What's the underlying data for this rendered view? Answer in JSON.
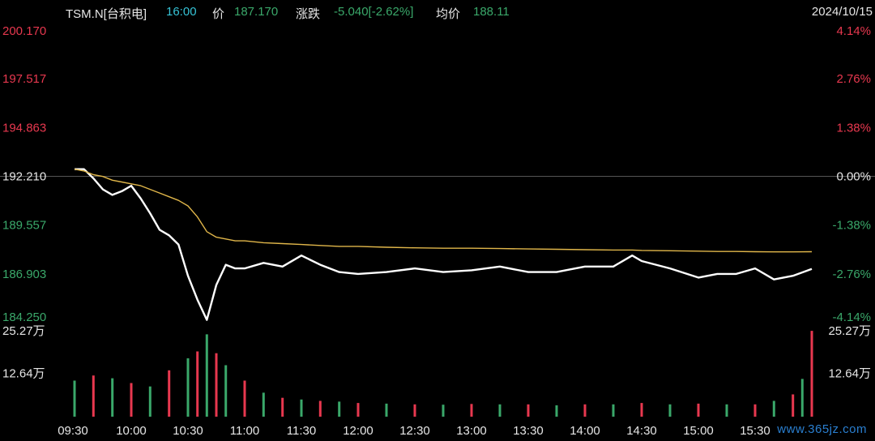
{
  "header": {
    "symbol": "TSM.N[台积电]",
    "time": "16:00",
    "price_label": "价",
    "price": "187.170",
    "change_label": "涨跌",
    "change": "-5.040[-2.62%]",
    "avg_label": "均价",
    "avg": "188.11",
    "date": "2024/10/15"
  },
  "colors": {
    "up": "#e8384f",
    "down": "#3aa86a",
    "price_line": "#ffffff",
    "avg_line": "#e0b64a",
    "base_line": "#555555"
  },
  "watermark": "www.365jz.com",
  "chart_data": [
    {
      "type": "line",
      "title": "",
      "xlabel": "",
      "ylabel": "",
      "x_ticks": [
        "09:30",
        "10:00",
        "10:30",
        "11:00",
        "11:30",
        "12:00",
        "12:30",
        "13:00",
        "13:30",
        "14:00",
        "14:30",
        "15:00",
        "15:30"
      ],
      "y_ticks_left": [
        "200.170",
        "197.517",
        "194.863",
        "192.210",
        "189.557",
        "186.903",
        "184.250"
      ],
      "y_ticks_right": [
        "4.14%",
        "2.76%",
        "1.38%",
        "0.00%",
        "-1.38%",
        "-2.76%",
        "-4.14%"
      ],
      "ylim": [
        184.25,
        200.17
      ],
      "prev_close": 192.21,
      "x": [
        "09:30",
        "09:35",
        "09:40",
        "09:45",
        "09:50",
        "09:55",
        "10:00",
        "10:05",
        "10:10",
        "10:15",
        "10:20",
        "10:25",
        "10:30",
        "10:35",
        "10:40",
        "10:45",
        "10:50",
        "10:55",
        "11:00",
        "11:10",
        "11:20",
        "11:30",
        "11:40",
        "11:50",
        "12:00",
        "12:15",
        "12:30",
        "12:45",
        "13:00",
        "13:15",
        "13:30",
        "13:45",
        "14:00",
        "14:15",
        "14:25",
        "14:30",
        "14:45",
        "15:00",
        "15:10",
        "15:20",
        "15:30",
        "15:40",
        "15:50",
        "16:00"
      ],
      "series": [
        {
          "values": [
            192.6,
            192.6,
            192.1,
            191.5,
            191.2,
            191.4,
            191.7,
            191.0,
            190.2,
            189.3,
            189.0,
            188.5,
            186.8,
            185.5,
            184.4,
            186.3,
            187.4,
            187.2,
            187.2,
            187.5,
            187.3,
            187.9,
            187.4,
            187.0,
            186.9,
            187.0,
            187.2,
            187.0,
            187.1,
            187.3,
            187.0,
            187.0,
            187.3,
            187.3,
            187.9,
            187.6,
            187.2,
            186.7,
            186.9,
            186.9,
            187.2,
            186.6,
            186.8,
            187.17
          ]
        },
        {
          "values": [
            192.6,
            192.5,
            192.3,
            192.2,
            192.0,
            191.9,
            191.8,
            191.7,
            191.5,
            191.3,
            191.1,
            190.9,
            190.6,
            190.0,
            189.2,
            188.9,
            188.8,
            188.7,
            188.7,
            188.6,
            188.55,
            188.5,
            188.45,
            188.4,
            188.4,
            188.35,
            188.32,
            188.3,
            188.3,
            188.28,
            188.26,
            188.24,
            188.22,
            188.2,
            188.2,
            188.18,
            188.16,
            188.14,
            188.12,
            188.12,
            188.11,
            188.1,
            188.1,
            188.11
          ]
        }
      ]
    },
    {
      "type": "bar",
      "title": "",
      "xlabel": "",
      "ylabel": "",
      "y_ticks_left": [
        "25.27万",
        "12.64万"
      ],
      "y_ticks_right": [
        "25.27万",
        "12.64万"
      ],
      "ylim": [
        0,
        25.27
      ],
      "unit": "万",
      "x": [
        "09:30",
        "09:40",
        "09:50",
        "10:00",
        "10:10",
        "10:20",
        "10:30",
        "10:35",
        "10:40",
        "10:45",
        "10:50",
        "11:00",
        "11:10",
        "11:20",
        "11:30",
        "11:40",
        "11:50",
        "12:00",
        "12:15",
        "12:30",
        "12:45",
        "13:00",
        "13:15",
        "13:30",
        "13:45",
        "14:00",
        "14:15",
        "14:30",
        "14:45",
        "15:00",
        "15:15",
        "15:30",
        "15:40",
        "15:50",
        "15:55",
        "16:00"
      ],
      "values": [
        10.5,
        12.0,
        11.2,
        9.8,
        8.8,
        13.5,
        17.0,
        19.0,
        24.0,
        18.5,
        15.0,
        10.5,
        7.0,
        5.5,
        5.0,
        4.6,
        4.4,
        4.0,
        3.8,
        3.6,
        3.5,
        3.7,
        3.6,
        3.6,
        3.3,
        3.6,
        3.6,
        4.0,
        3.6,
        3.8,
        3.6,
        3.6,
        4.6,
        6.5,
        11.0,
        25.0
      ]
    }
  ]
}
